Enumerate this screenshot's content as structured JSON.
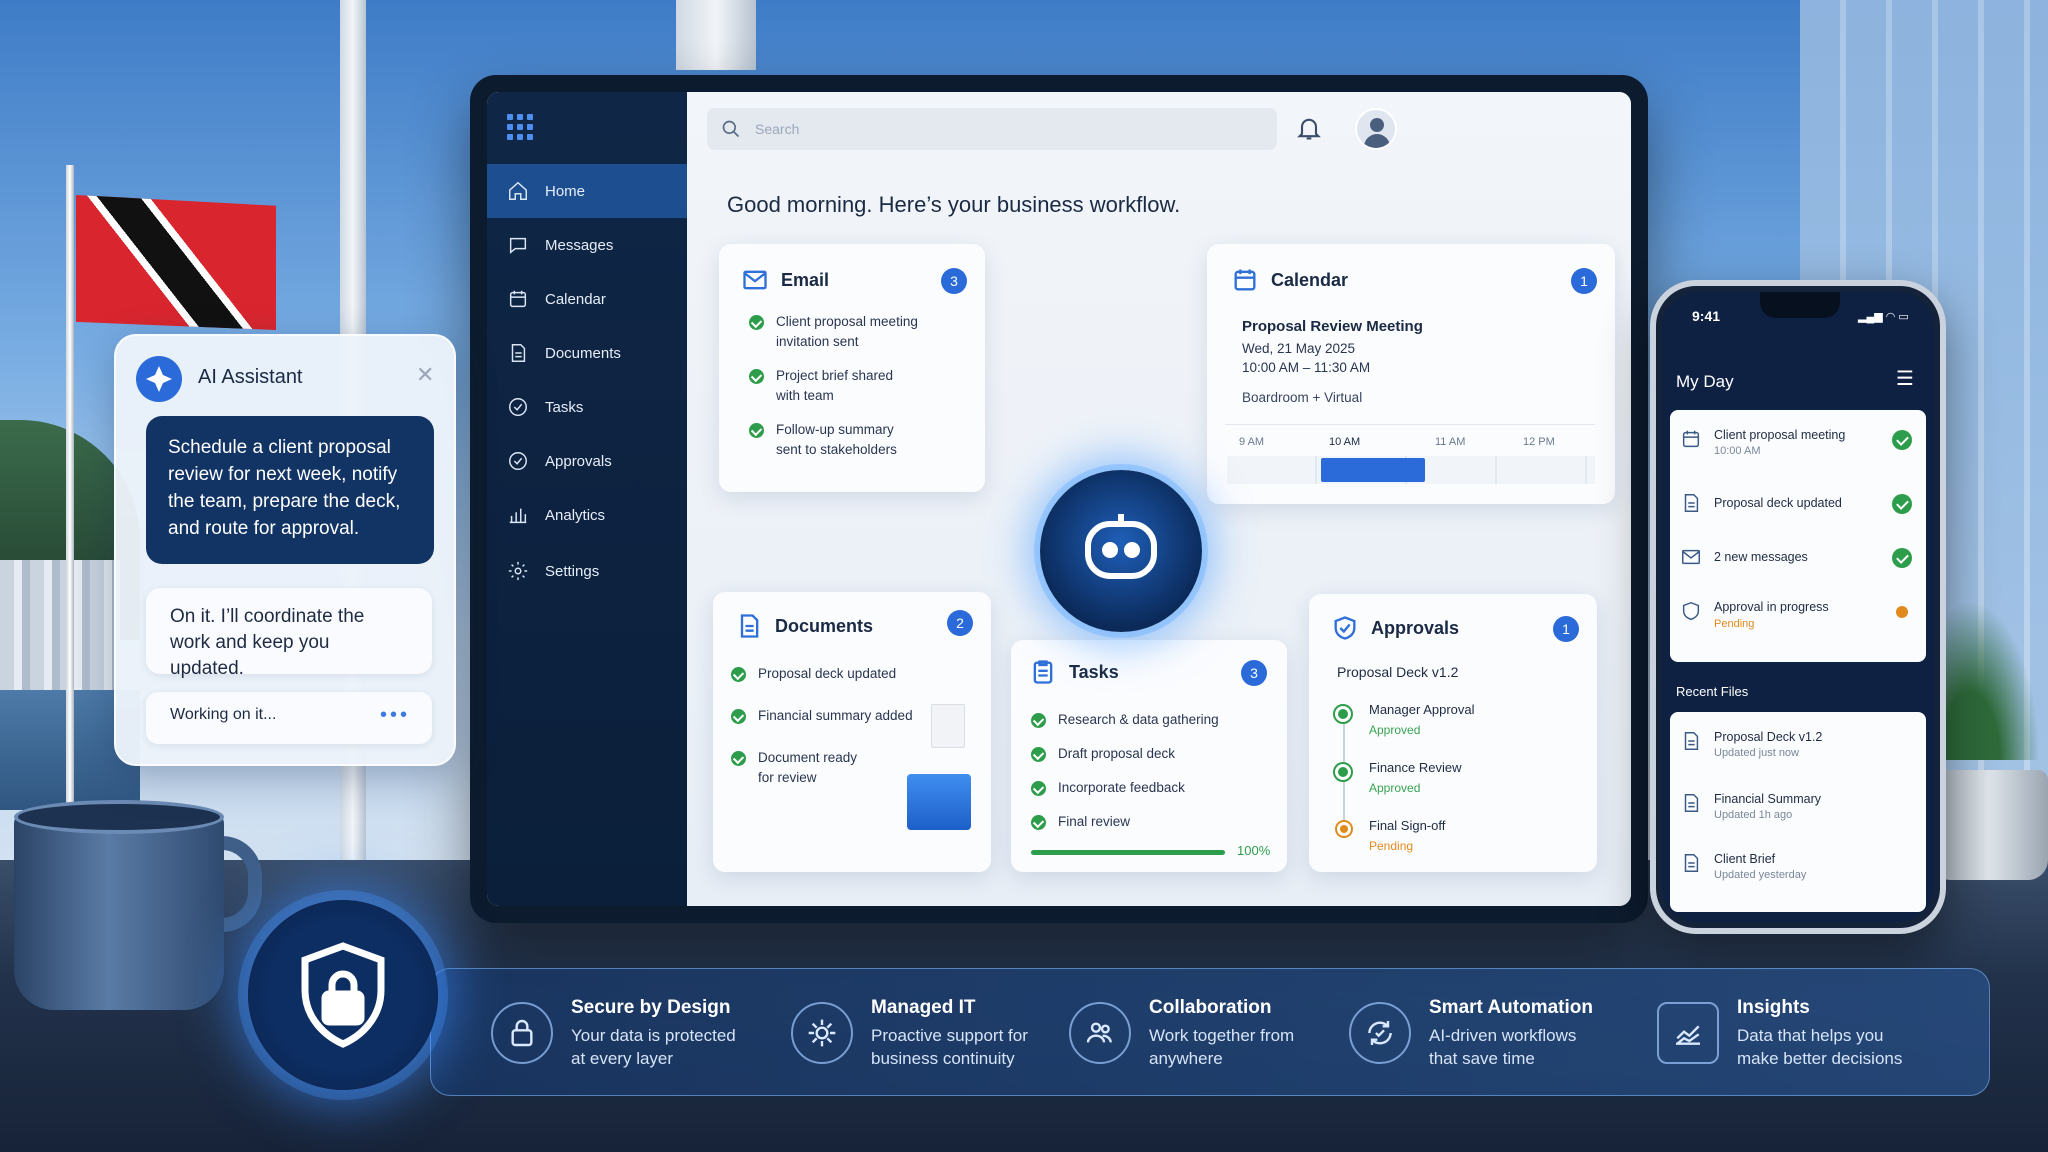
{
  "sidebar": {
    "items": [
      {
        "label": "Home",
        "icon": "home-icon"
      },
      {
        "label": "Messages",
        "icon": "chat-icon"
      },
      {
        "label": "Calendar",
        "icon": "calendar-icon"
      },
      {
        "label": "Documents",
        "icon": "document-icon"
      },
      {
        "label": "Tasks",
        "icon": "check-circle-icon"
      },
      {
        "label": "Approvals",
        "icon": "check-badge-icon"
      },
      {
        "label": "Analytics",
        "icon": "bar-chart-icon"
      },
      {
        "label": "Settings",
        "icon": "gear-icon"
      }
    ]
  },
  "header": {
    "search_placeholder": "Search"
  },
  "greeting": "Good morning. Here’s your business workflow.",
  "email": {
    "title": "Email",
    "count": "3",
    "items": [
      {
        "l1": "Client proposal meeting",
        "l2": "invitation sent"
      },
      {
        "l1": "Project brief shared",
        "l2": "with team"
      },
      {
        "l1": "Follow-up summary",
        "l2": "sent to stakeholders"
      }
    ]
  },
  "calendar": {
    "title": "Calendar",
    "count": "1",
    "event": "Proposal Review Meeting",
    "date": "Wed, 21 May 2025",
    "time": "10:00 AM – 11:30 AM",
    "location": "Boardroom + Virtual",
    "hours": [
      "9 AM",
      "10 AM",
      "11 AM",
      "12 PM"
    ]
  },
  "documents": {
    "title": "Documents",
    "count": "2",
    "items": [
      {
        "l1": "Proposal deck updated",
        "l2": ""
      },
      {
        "l1": "Financial summary added",
        "l2": ""
      },
      {
        "l1": "Document ready",
        "l2": "for review"
      }
    ]
  },
  "tasks": {
    "title": "Tasks",
    "count": "3",
    "items": [
      "Research & data gathering",
      "Draft proposal deck",
      "Incorporate feedback",
      "Final review"
    ],
    "progress_label": "100%",
    "progress": 1.0
  },
  "approvals": {
    "title": "Approvals",
    "count": "1",
    "subject": "Proposal Deck v1.2",
    "steps": [
      {
        "name": "Manager Approval",
        "status": "Approved"
      },
      {
        "name": "Finance Review",
        "status": "Approved"
      },
      {
        "name": "Final Sign-off",
        "status": "Pending"
      }
    ]
  },
  "assistant": {
    "title": "AI Assistant",
    "user_message": "Schedule a client proposal review for next week, notify the team, prepare the deck, and route for approval.",
    "reply": "On it. I’ll coordinate the work and keep you updated.",
    "status": "Working on it..."
  },
  "phone": {
    "time": "9:41",
    "title": "My Day",
    "day_items": [
      {
        "label": "Client proposal meeting",
        "sub": "10:00 AM",
        "state": "done"
      },
      {
        "label": "Proposal deck updated",
        "sub": "",
        "state": "done"
      },
      {
        "label": "2 new messages",
        "sub": "",
        "state": "done"
      },
      {
        "label": "Approval in progress",
        "sub": "Pending",
        "state": "pending"
      }
    ],
    "recent_title": "Recent Files",
    "files": [
      {
        "label": "Proposal Deck v1.2",
        "sub": "Updated just now"
      },
      {
        "label": "Financial Summary",
        "sub": "Updated 1h ago"
      },
      {
        "label": "Client Brief",
        "sub": "Updated yesterday"
      }
    ]
  },
  "features": [
    {
      "title": "Secure by Design",
      "d1": "Your data is protected",
      "d2": "at every layer",
      "icon": "lock-icon"
    },
    {
      "title": "Managed IT",
      "d1": "Proactive support for",
      "d2": "business continuity",
      "icon": "gear-icon"
    },
    {
      "title": "Collaboration",
      "d1": "Work together from",
      "d2": "anywhere",
      "icon": "people-icon"
    },
    {
      "title": "Smart Automation",
      "d1": "AI-driven workflows",
      "d2": "that save time",
      "icon": "automation-icon"
    },
    {
      "title": "Insights",
      "d1": "Data that helps you",
      "d2": "make better decisions",
      "icon": "chart-icon"
    }
  ],
  "colors": {
    "accent": "#2a6ad9",
    "sidebar": "#0f2646",
    "success": "#2e9d4b",
    "pending": "#e08a1c"
  }
}
